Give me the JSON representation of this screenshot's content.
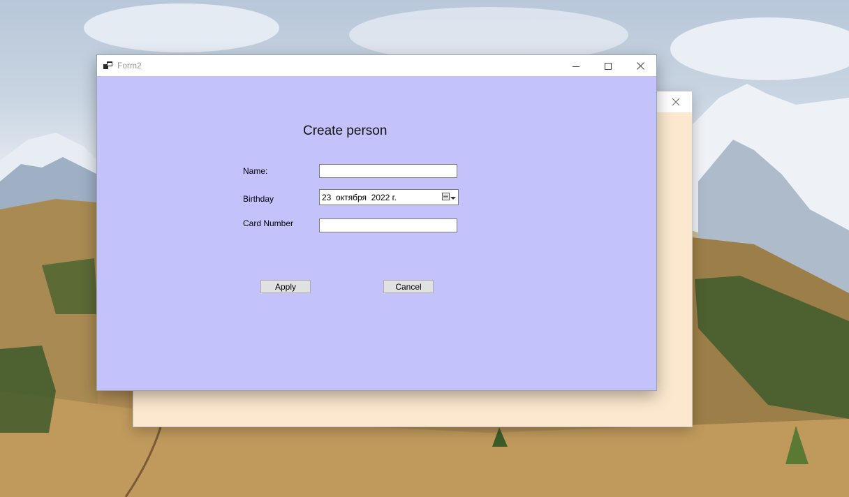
{
  "window": {
    "title": "Form2",
    "icons": {
      "app": "windows-form-icon",
      "minimize": "minimize-icon",
      "maximize": "maximize-icon",
      "close": "close-icon"
    }
  },
  "form": {
    "heading": "Create person",
    "name_label": "Name:",
    "name_value": "",
    "birthday_label": "Birthday",
    "birthday_value": "23  октября  2022 г.",
    "card_label": "Card Number",
    "card_value": "",
    "apply_label": "Apply",
    "cancel_label": "Cancel"
  },
  "colors": {
    "form_background": "#c4c2fb",
    "background_window": "#fce8cf"
  }
}
